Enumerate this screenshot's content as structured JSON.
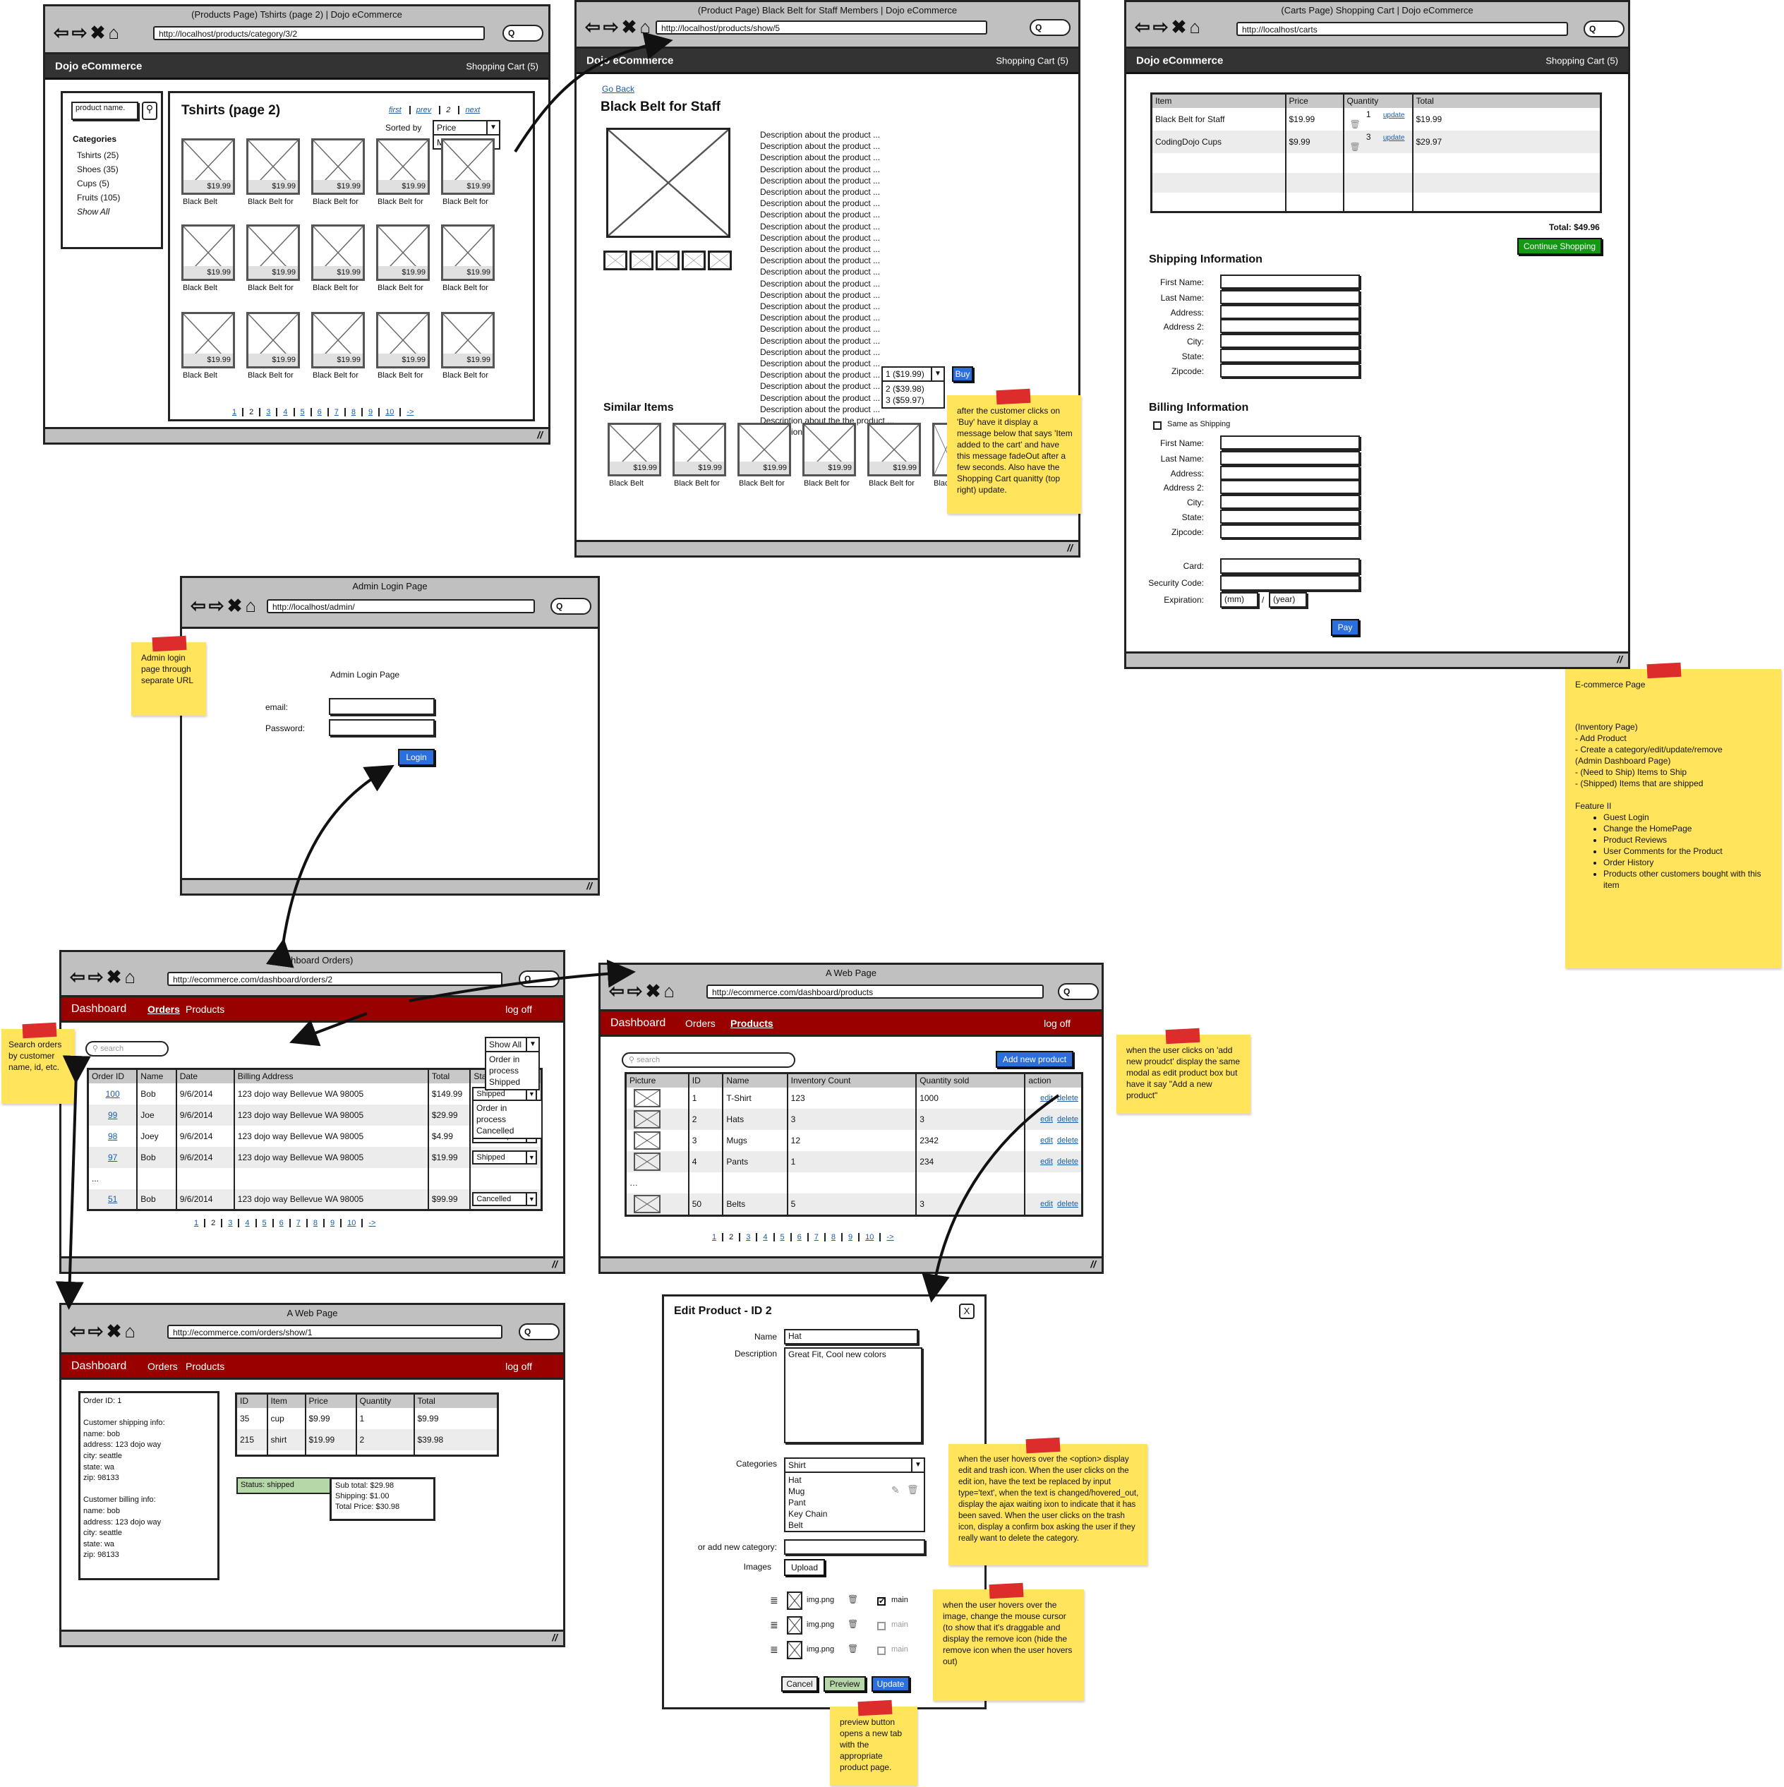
{
  "products_page": {
    "window_title": "(Products Page) Tshirts (page 2) | Dojo eCommerce",
    "url": "http://localhost/products/category/3/2",
    "brand": "Dojo eCommerce",
    "cart": "Shopping Cart (5)",
    "search_placeholder": "product name.",
    "categories_heading": "Categories",
    "categories": [
      "Tshirts (25)",
      "Shoes (35)",
      "Cups (5)",
      "Fruits (105)"
    ],
    "show_all": "Show All",
    "heading": "Tshirts (page 2)",
    "top_pager": {
      "first": "first",
      "prev": "prev",
      "current": "2",
      "next": "next"
    },
    "sorted_by_label": "Sorted by",
    "sort_selected": "Price",
    "sort_options": [
      "Most Popular"
    ],
    "grid": {
      "price": "$19.99",
      "captions": [
        "Black Belt",
        "Black Belt for",
        "Black Belt for",
        "Black Belt for",
        "Black Belt for"
      ]
    },
    "pager": [
      "1",
      "2",
      "3",
      "4",
      "5",
      "6",
      "7",
      "8",
      "9",
      "10",
      "->"
    ],
    "pager_current": "2"
  },
  "product_page": {
    "window_title": "(Product Page) Black Belt for Staff Members | Dojo eCommerce",
    "url": "http://localhost/products/show/5",
    "brand": "Dojo eCommerce",
    "cart": "Shopping Cart (5)",
    "go_back": "Go Back",
    "title": "Black Belt for Staff",
    "description": "Description about the product ... Description about the product ... Description about the product ... Description about the product ... Description about the product ... Description about the product ... Description about the product ... Description about the product ... Description about the product ... Description about the product ... Description about the product ... Description about the product ... Description about the product ... Description about the product ... Description about the product ... Description about the product ... Description about the product ... Description about the product ... Description about the product ... Description about the product ... Description about the product ... Description about the product ... Description about the product ... Description about the product ... Description about the product ... Description about the the product ... Description about the",
    "qty_selected": "1 ($19.99)",
    "qty_options": [
      "2 ($39.98)",
      "3 ($59.97)"
    ],
    "buy": "Buy",
    "similar_heading": "Similar Items",
    "similar_price": "$19.99",
    "similar_captions": [
      "Black Belt",
      "Black Belt for",
      "Black Belt for",
      "Black Belt for",
      "Black Belt for",
      "Blac"
    ]
  },
  "cart_page": {
    "window_title": "(Carts Page) Shopping Cart | Dojo eCommerce",
    "url": "http://localhost/carts",
    "brand": "Dojo eCommerce",
    "cart": "Shopping Cart (5)",
    "columns": [
      "Item",
      "Price",
      "Quantity",
      "Total"
    ],
    "rows": [
      {
        "item": "Black Belt for Staff",
        "price": "$19.99",
        "qty": "1",
        "update": "update",
        "total": "$19.99"
      },
      {
        "item": "CodingDojo Cups",
        "price": "$9.99",
        "qty": "3",
        "update": "update",
        "total": "$29.97"
      }
    ],
    "total": "Total: $49.96",
    "continue": "Continue Shopping",
    "shipping_heading": "Shipping Information",
    "shipping_fields": [
      "First Name:",
      "Last Name:",
      "Address:",
      "Address 2:",
      "City:",
      "State:",
      "Zipcode:"
    ],
    "billing_heading": "Billing Information",
    "same_as_shipping": "Same as Shipping",
    "billing_fields": [
      "First Name:",
      "Last Name:",
      "Address:",
      "Address 2:",
      "City:",
      "State:",
      "Zipcode:"
    ],
    "card_label": "Card:",
    "security_label": "Security Code:",
    "expiration_label": "Expiration:",
    "mm_placeholder": "(mm)",
    "slash": "/",
    "year_placeholder": "(year)",
    "pay": "Pay"
  },
  "admin_login": {
    "window_title": "Admin Login Page",
    "url": "http://localhost/admin/",
    "heading": "Admin Login Page",
    "email_label": "email:",
    "password_label": "Password:",
    "login": "Login"
  },
  "dashboard_orders": {
    "window_title": "(Dashboard Orders)",
    "url": "http://ecommerce.com/dashboard/orders/2",
    "nav": {
      "brand": "Dashboard",
      "orders": "Orders",
      "products": "Products",
      "logoff": "log off"
    },
    "search_placeholder": "search",
    "filter_selected": "Show All",
    "filter_options": [
      "Order in process",
      "Shipped"
    ],
    "columns": [
      "Order ID",
      "Name",
      "Date",
      "Billing Address",
      "Total",
      "Status"
    ],
    "rows": [
      {
        "id": "100",
        "name": "Bob",
        "date": "9/6/2014",
        "address": "123 dojo way Bellevue WA 98005",
        "total": "$149.99",
        "status": "Shipped"
      },
      {
        "id": "99",
        "name": "Joe",
        "date": "9/6/2014",
        "address": "123 dojo way Bellevue WA 98005",
        "total": "$29.99",
        "status": ""
      },
      {
        "id": "98",
        "name": "Joey",
        "date": "9/6/2014",
        "address": "123 dojo way Bellevue WA 98005",
        "total": "$4.99",
        "status": "Order in process"
      },
      {
        "id": "97",
        "name": "Bob",
        "date": "9/6/2014",
        "address": "123 dojo way Bellevue WA 98005",
        "total": "$19.99",
        "status": "Shipped"
      },
      {
        "id": "...",
        "name": "",
        "date": "",
        "address": "",
        "total": "",
        "status": ""
      },
      {
        "id": "51",
        "name": "Bob",
        "date": "9/6/2014",
        "address": "123 dojo way Bellevue WA 98005",
        "total": "$99.99",
        "status": "Cancelled"
      }
    ],
    "status_open_options": [
      "Order in process",
      "Cancelled"
    ],
    "pager": [
      "1",
      "2",
      "3",
      "4",
      "5",
      "6",
      "7",
      "8",
      "9",
      "10",
      "->"
    ],
    "pager_current": "2"
  },
  "dashboard_products": {
    "window_title": "A Web Page",
    "url": "http://ecommerce.com/dashboard/products",
    "nav": {
      "brand": "Dashboard",
      "orders": "Orders",
      "products": "Products",
      "logoff": "log off"
    },
    "search_placeholder": "search",
    "add_new": "Add new product",
    "columns": [
      "Picture",
      "ID",
      "Name",
      "Inventory Count",
      "Quantity sold",
      "action"
    ],
    "rows": [
      {
        "id": "1",
        "name": "T-Shirt",
        "inventory": "123",
        "sold": "1000",
        "pic": true
      },
      {
        "id": "2",
        "name": "Hats",
        "inventory": "3",
        "sold": "3",
        "pic": true
      },
      {
        "id": "3",
        "name": "Mugs",
        "inventory": "12",
        "sold": "2342",
        "pic": true
      },
      {
        "id": "4",
        "name": "Pants",
        "inventory": "1",
        "sold": "234",
        "pic": true
      },
      {
        "id": "...",
        "name": "",
        "inventory": "",
        "sold": "",
        "pic": false
      },
      {
        "id": "50",
        "name": "Belts",
        "inventory": "5",
        "sold": "3",
        "pic": true
      }
    ],
    "edit": "edit",
    "delete": "delete",
    "pager": [
      "1",
      "2",
      "3",
      "4",
      "5",
      "6",
      "7",
      "8",
      "9",
      "10",
      "->"
    ],
    "pager_current": "2"
  },
  "order_detail": {
    "window_title": "A Web Page",
    "url": "http://ecommerce.com/orders/show/1",
    "nav": {
      "brand": "Dashboard",
      "orders": "Orders",
      "products": "Products",
      "logoff": "log off"
    },
    "info": "Order ID: 1\n\nCustomer shipping info:\nname: bob\naddress: 123 dojo way\ncity: seattle\nstate: wa\nzip: 98133\n\nCustomer billing info:\nname: bob\naddress: 123 dojo way\ncity: seattle\nstate: wa\nzip: 98133",
    "columns": [
      "ID",
      "Item",
      "Price",
      "Quantity",
      "Total"
    ],
    "rows": [
      {
        "id": "35",
        "item": "cup",
        "price": "$9.99",
        "qty": "1",
        "total": "$9.99"
      },
      {
        "id": "215",
        "item": "shirt",
        "price": "$19.99",
        "qty": "2",
        "total": "$39.98"
      }
    ],
    "status": "Status: shipped",
    "summary": "Sub total: $29.98\nShipping: $1.00\nTotal Price: $30.98"
  },
  "edit_modal": {
    "title": "Edit Product - ID 2",
    "close": "X",
    "name_label": "Name",
    "name_value": "Hat",
    "description_label": "Description",
    "description_value": "Great Fit, Cool new colors",
    "categories_label": "Categories",
    "category_selected": "Shirt",
    "category_options": [
      "Hat",
      "Mug",
      "Pant",
      "Key Chain",
      "Belt"
    ],
    "new_category_label": "or add new category:",
    "images_label": "Images",
    "upload": "Upload",
    "images": [
      {
        "name": "img.png",
        "main_label": "main",
        "main": true
      },
      {
        "name": "img.png",
        "main_label": "main",
        "main": false
      },
      {
        "name": "img.png",
        "main_label": "main",
        "main": false
      }
    ],
    "cancel": "Cancel",
    "preview": "Preview",
    "update": "Update"
  },
  "notes": {
    "buy_note": "after the customer clicks on 'Buy' have it display a message below that says 'Item added to the cart' and have this message fadeOut after a few seconds.  Also have the Shopping Cart quanitty (top right) update.",
    "admin_note": "Admin login page through separate URL",
    "search_note": "Search orders by customer name, id, etc.",
    "add_product_note": "when the user clicks on 'add new proudct' display the same modal as edit product box but have it say \"Add a new product\"",
    "category_note": "when the user hovers over the <option> display edit and trash icon.  When the user clicks on the edit ion, have the text be replaced by input type='text', when the text is changed/hovered_out, display the ajax waiting ixon to indicate that it has been saved.  When the user clicks on the trash icon, display a confirm box asking the user if they really want to delete the category.",
    "image_note": "when the user hovers over the image, change the mouse cursor (to show that it's draggable and display the remove icon (hide the remove icon when the user hovers out)",
    "preview_note": "preview button opens a new tab with the appropriate product page.",
    "ecommerce_note": {
      "title": "E-commerce Page",
      "body": "(Inventory Page)\n - Add Product\n - Create a category/edit/update/remove\n(Admin Dashboard Page)\n - (Need to Ship) Items to Ship\n - (Shipped) Items that are shipped",
      "feature_heading": "Feature II",
      "features": [
        "Guest Login",
        "Change the HomePage",
        "Product Reviews",
        "User Comments for the Product",
        "Order History",
        "Products other customers bought with this item"
      ]
    }
  },
  "colors": {
    "chrome": "#c0c0c0",
    "dark_bar": "#333333",
    "admin_bar": "#990000",
    "primary_button": "#2a6fdb",
    "continue_button": "#119a11",
    "sticky": "#ffe45c",
    "tape": "#dd2c2c",
    "status_green": "#b6d7a8"
  }
}
